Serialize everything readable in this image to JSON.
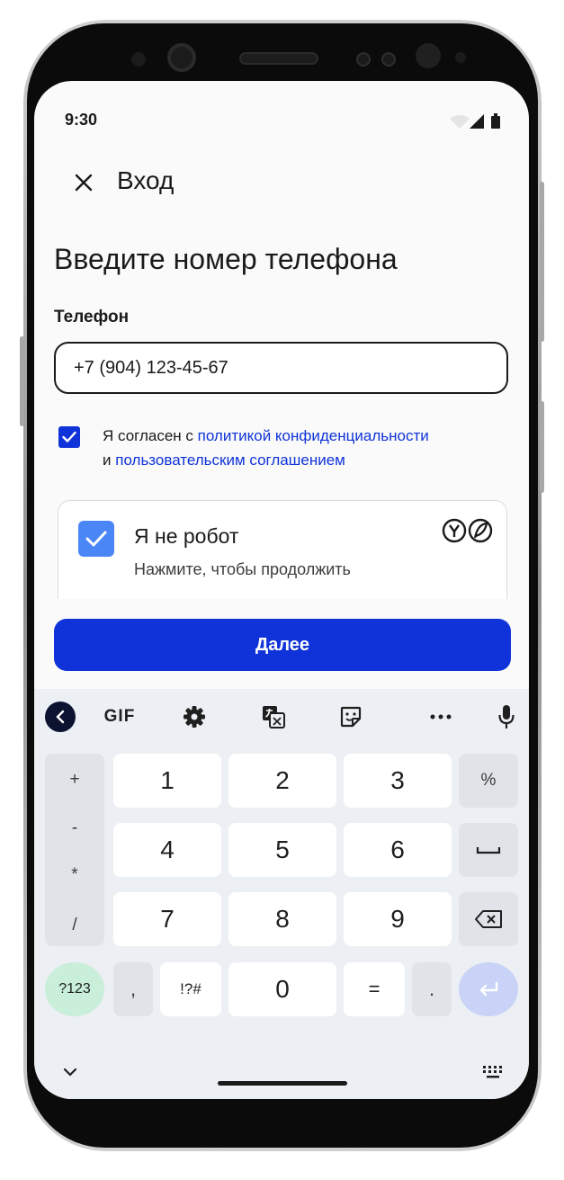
{
  "status_bar": {
    "time": "9:30"
  },
  "app_bar": {
    "title": "Вход"
  },
  "heading": "Введите номер телефона",
  "phone_field": {
    "label": "Телефон",
    "value": "+7 (904) 123-45-67"
  },
  "agreement": {
    "checked": true,
    "text_1": "Я согласен с ",
    "link_1": "политикой конфиденциальности",
    "text_2": "и ",
    "link_2": "пользовательским соглашением"
  },
  "captcha": {
    "checked": true,
    "title": "Я не робот",
    "subtitle": "Нажмите, чтобы продолжить"
  },
  "next_button": "Далее",
  "keyboard": {
    "toolbar": {
      "gif": "GIF"
    },
    "symbols": [
      "+",
      "-",
      "*",
      "/"
    ],
    "digits_row1": [
      "1",
      "2",
      "3"
    ],
    "digits_row2": [
      "4",
      "5",
      "6"
    ],
    "digits_row3": [
      "7",
      "8",
      "9"
    ],
    "percent": "%",
    "mode_key": "?123",
    "comma": ",",
    "special": "!?#",
    "zero": "0",
    "equals": "=",
    "period": "."
  },
  "colors": {
    "primary": "#0f33d9",
    "captcha_check": "#4a86f5",
    "keyboard_bg": "#eceff3"
  }
}
